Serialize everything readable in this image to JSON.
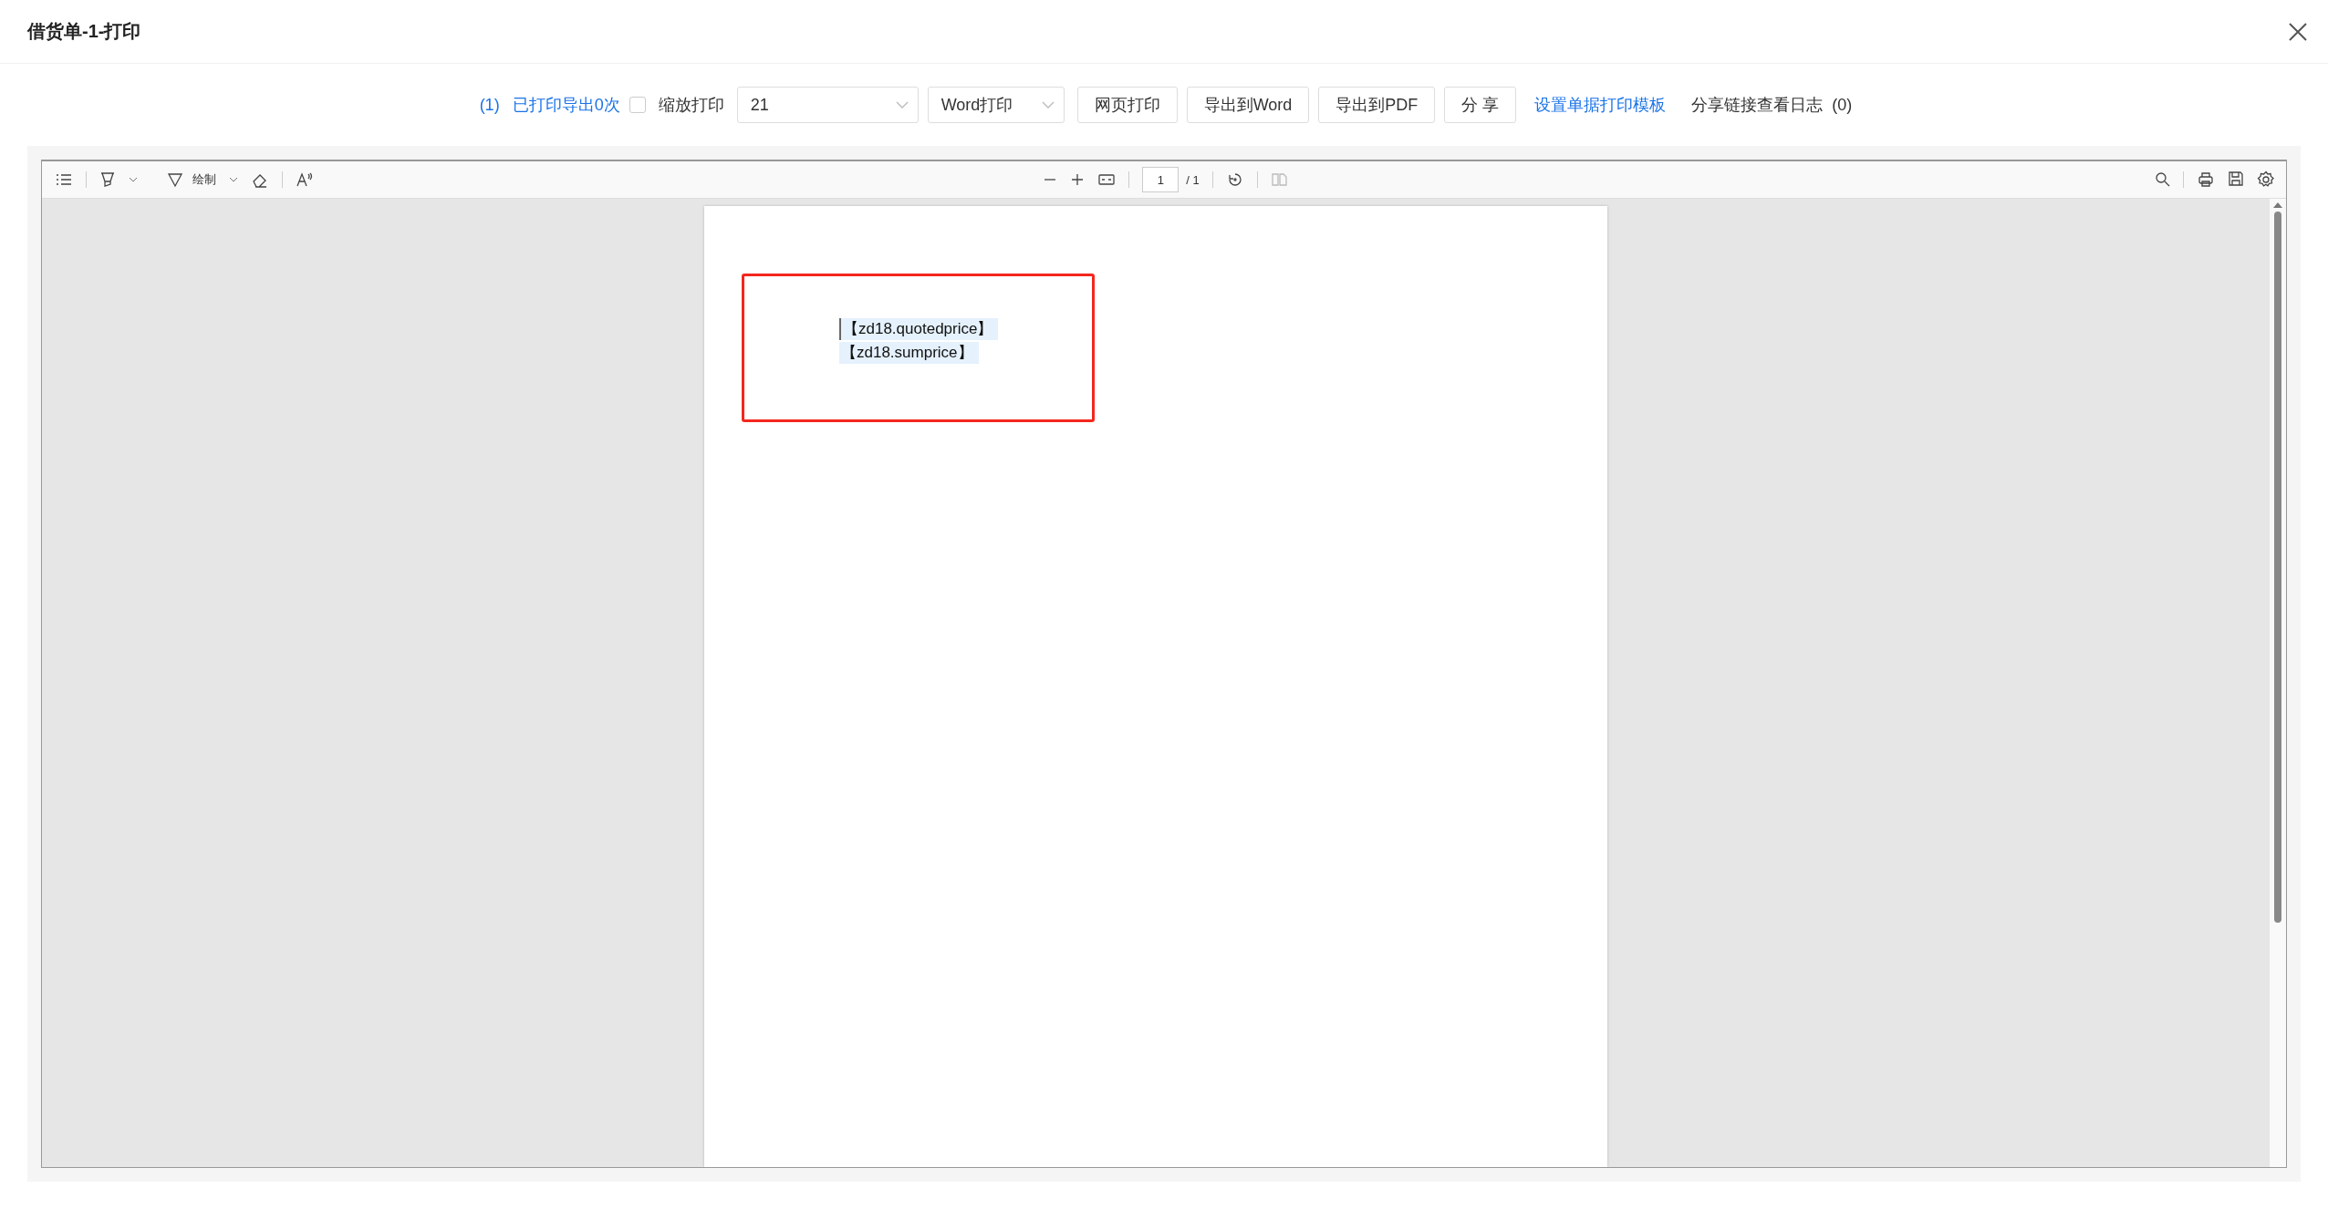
{
  "window": {
    "title": "借货单-1-打印"
  },
  "toolbar": {
    "print_count": "(1)",
    "print_status_link": "已打印导出0次",
    "zoom_print": {
      "label": "缩放打印",
      "checked": false
    },
    "template_select": {
      "value": "21"
    },
    "print_mode_select": {
      "value": "Word打印"
    },
    "buttons": [
      "网页打印",
      "导出到Word",
      "导出到PDF",
      "分 享"
    ],
    "template_link": "设置单据打印模板",
    "share_log": {
      "label": "分享链接查看日志",
      "count": "(0)"
    }
  },
  "viewer": {
    "draw_label": "绘制",
    "page_input": "1",
    "page_total": "/ 1",
    "page_fields": [
      "【zd18.quotedprice】",
      "【zd18.sumprice】"
    ]
  }
}
